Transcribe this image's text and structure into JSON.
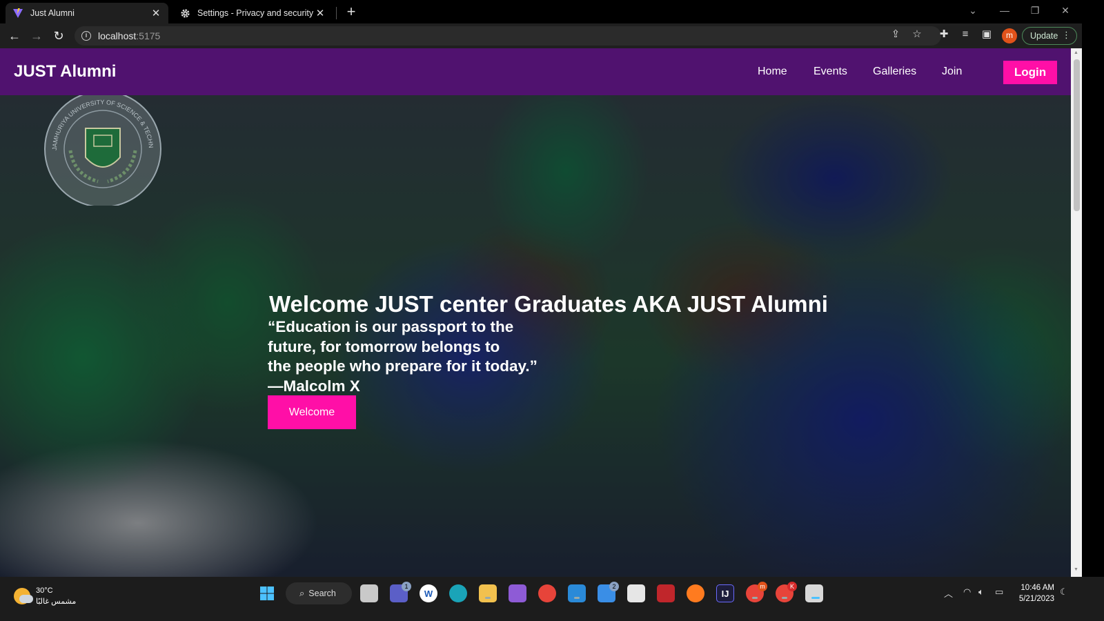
{
  "browser": {
    "tabs": [
      {
        "title": "Just Alumni",
        "active": true
      },
      {
        "title": "Settings - Privacy and security",
        "active": false
      }
    ],
    "address": {
      "host": "localhost",
      "port": ":5175"
    },
    "update_label": "Update",
    "profile_initial": "m"
  },
  "navbar": {
    "brand": "JUST Alumni",
    "links": [
      "Home",
      "Events",
      "Galleries",
      "Join"
    ],
    "login_label": "Login",
    "background": "#50126f"
  },
  "hero": {
    "title": "Welcome JUST center Graduates AKA JUST Alumni",
    "quote_lines": [
      "“Education is our passport to the",
      "future, for tomorrow belongs to",
      "the people who prepare for it today.”",
      "—Malcolm X"
    ],
    "button_label": "Welcome",
    "accent": "#ff0fa7",
    "seal_text": "JAMHURIYA UNIVERSITY OF SCIENCE & TECHNOLOGY"
  },
  "taskbar": {
    "weather_temp": "30°C",
    "weather_desc": "مشمس غالبًا",
    "search_label": "Search",
    "badges": {
      "teams": "1",
      "mail": "2",
      "chrome_m": "m",
      "chrome_k": "K"
    },
    "time": "10:46 AM",
    "date": "5/21/2023"
  }
}
